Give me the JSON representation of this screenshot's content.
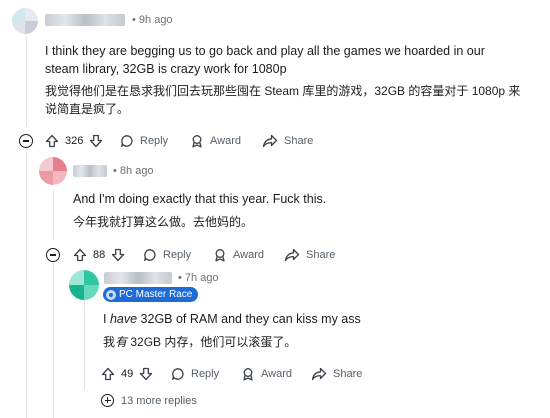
{
  "comments": [
    {
      "time": "• 9h ago",
      "text_en": "I think they are begging us to go back and play all the games we hoarded in our steam library, 32GB is crazy work for 1080p",
      "text_cn": "我觉得他们是在恳求我们回去玩那些囤在 Steam 库里的游戏，32GB 的容量对于 1080p 来说简直是疯了。",
      "votes": "326",
      "reply": "Reply",
      "award": "Award",
      "share": "Share"
    },
    {
      "time": "• 8h ago",
      "text_en": "And I'm doing exactly that this year. Fuck this.",
      "text_cn": "今年我就打算这么做。去他妈的。",
      "votes": "88",
      "reply": "Reply",
      "award": "Award",
      "share": "Share"
    },
    {
      "time": "• 7h ago",
      "flair": "PC Master Race",
      "text_en_pre": "I ",
      "text_en_em": "have",
      "text_en_post": " 32GB of RAM and they can kiss my ass",
      "text_cn_pre": "我",
      "text_cn_em": "有",
      "text_cn_post": " 32GB 内存，他们可以滚蛋了。",
      "votes": "49",
      "reply": "Reply",
      "award": "Award",
      "share": "Share"
    }
  ],
  "more_replies": "13 more replies",
  "icons": [
    "upvote-icon",
    "downvote-icon",
    "reply-icon",
    "award-icon",
    "share-icon",
    "collapse-icon",
    "expand-icon",
    "flair-icon"
  ],
  "colors": {
    "flair_bg": "#1e6bd6",
    "thread_line": "#e2e5e8",
    "meta_text": "#6a7178"
  }
}
